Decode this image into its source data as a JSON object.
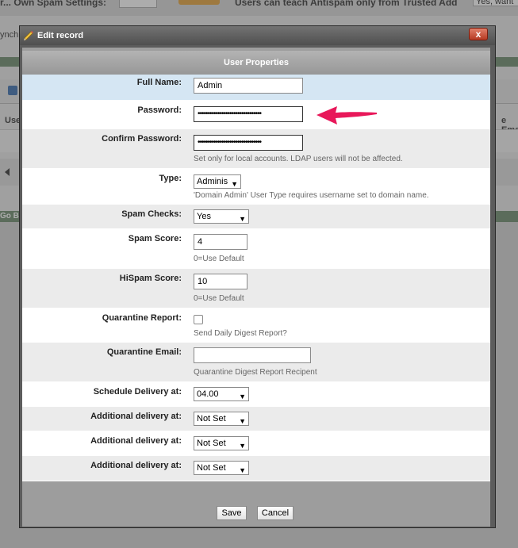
{
  "background": {
    "top_left_text": "r... Own Spam Settings:",
    "top_right_text": "Users can teach Antispam only from Trusted Add",
    "top_right_box": "Yes, want",
    "sync_text": "ynchr",
    "col_use": "Use",
    "col_email": "e Ema",
    "go_text": "Go B"
  },
  "dialog": {
    "title": "Edit record",
    "close_label": "x",
    "section_title": "User Properties"
  },
  "form": {
    "full_name": {
      "label": "Full Name:",
      "value": "Admin"
    },
    "password": {
      "label": "Password:",
      "value": "••••••••••••••••••••••••••••••••"
    },
    "confirm_password": {
      "label": "Confirm Password:",
      "value": "••••••••••••••••••••••••••••••••",
      "hint": "Set only for local accounts. LDAP users will not be affected."
    },
    "type": {
      "label": "Type:",
      "value": "Adminis",
      "hint": "'Domain Admin' User Type requires username set to domain name."
    },
    "spam_checks": {
      "label": "Spam Checks:",
      "value": "Yes"
    },
    "spam_score": {
      "label": "Spam Score:",
      "value": "4",
      "hint": "0=Use Default"
    },
    "hispam_score": {
      "label": "HiSpam Score:",
      "value": "10",
      "hint": "0=Use Default"
    },
    "quarantine_report": {
      "label": "Quarantine Report:",
      "checked": false,
      "hint": "Send Daily Digest Report?"
    },
    "quarantine_email": {
      "label": "Quarantine Email:",
      "value": "",
      "hint": "Quarantine Digest Report Recipent"
    },
    "schedule_delivery": {
      "label": "Schedule Delivery at:",
      "value": "04.00"
    },
    "additional_delivery_1": {
      "label": "Additional delivery at:",
      "value": "Not Set"
    },
    "additional_delivery_2": {
      "label": "Additional delivery at:",
      "value": "Not Set"
    },
    "additional_delivery_3": {
      "label": "Additional delivery at:",
      "value": "Not Set"
    }
  },
  "buttons": {
    "save": "Save",
    "cancel": "Cancel"
  },
  "colors": {
    "annotation_arrow": "#e8185a",
    "highlight_row": "#d5e6f3"
  }
}
